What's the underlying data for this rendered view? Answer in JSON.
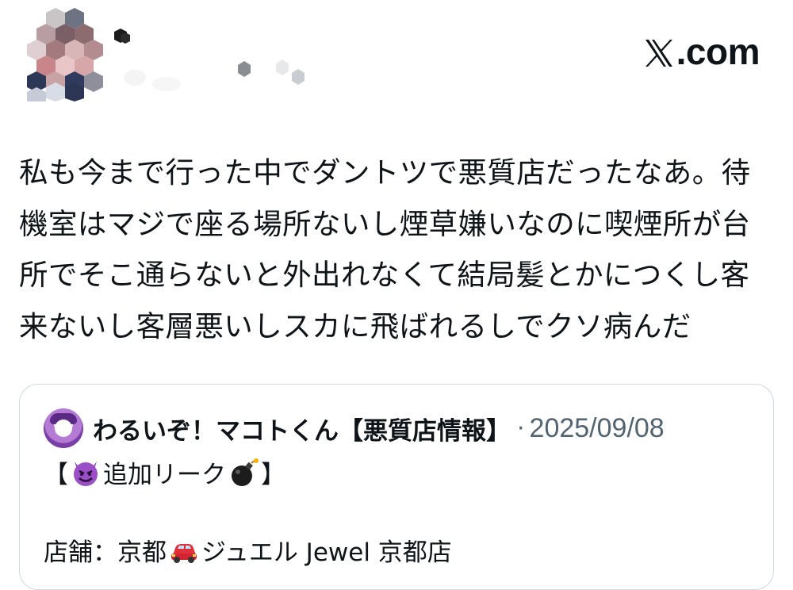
{
  "header": {
    "brand": ".com",
    "brand_icon": "x-logo-icon"
  },
  "post": {
    "text": "私も今まで行った中でダントツで悪質店だったなあ。待\n機室はマジで座る場所ないし煙草嫌いなのに喫煙所が台\n所でそこ通らないと外出れなくて結局髪とかにつくし客\n来ないし客層悪いしスカに飛ばれるしでクソ病んだ"
  },
  "quote": {
    "author": "わるいぞ！マコトくん【悪質店情報】",
    "separator": "·",
    "date": "2025/09/08",
    "line1_open": "【",
    "line1_emoji": "smiling-devil-emoji",
    "line1_text": "追加リーク",
    "line1_emoji2": "bomb-emoji",
    "line1_close": "】",
    "line2_label": "店舗：京都",
    "line2_emoji": "red-car-emoji",
    "line2_text": "ジュエル Jewel 京都店"
  },
  "colors": {
    "text": "#0f1419",
    "secondary": "#536471",
    "border": "#cfd9de"
  }
}
